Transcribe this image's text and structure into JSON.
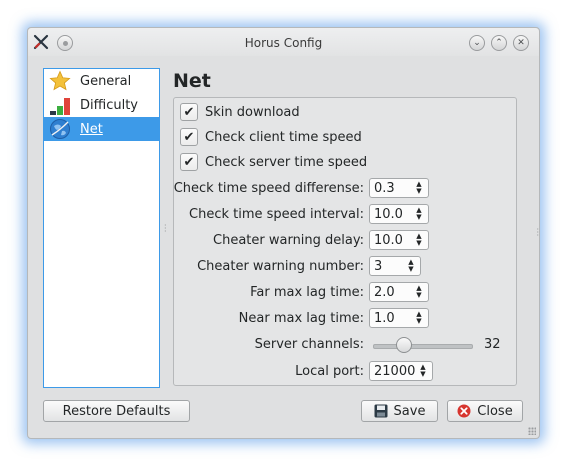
{
  "window": {
    "title": "Horus Config",
    "controls": [
      "minimize",
      "maximize",
      "close"
    ]
  },
  "sidebar": {
    "items": [
      {
        "label": "General",
        "icon": "star-icon",
        "selected": false
      },
      {
        "label": "Difficulty",
        "icon": "bar-chart-icon",
        "selected": false
      },
      {
        "label": "Net",
        "icon": "globe-icon",
        "selected": true
      }
    ]
  },
  "page": {
    "title": "Net",
    "checks": [
      {
        "label": "Skin download",
        "checked": true
      },
      {
        "label": "Check client time speed",
        "checked": true
      },
      {
        "label": "Check server time speed",
        "checked": true
      }
    ],
    "fields": {
      "speed_difference": {
        "label": "Check time speed differense:",
        "value": "0.3"
      },
      "speed_interval": {
        "label": "Check time speed interval:",
        "value": "10.0"
      },
      "warning_delay": {
        "label": "Cheater warning delay:",
        "value": "10.0"
      },
      "warning_number": {
        "label": "Cheater warning number:",
        "value": "3"
      },
      "far_lag": {
        "label": "Far max lag time:",
        "value": "2.0"
      },
      "near_lag": {
        "label": "Near max lag time:",
        "value": "1.0"
      },
      "server_channels": {
        "label": "Server channels:",
        "value": "32",
        "fraction": 0.28
      },
      "local_port": {
        "label": "Local port:",
        "value": "21000"
      }
    }
  },
  "buttons": {
    "restore": "Restore Defaults",
    "save": "Save",
    "close": "Close"
  },
  "colors": {
    "accent": "#3d9ae8",
    "window_bg": "#dfe0e1",
    "close_icon_red": "#d7352f"
  }
}
